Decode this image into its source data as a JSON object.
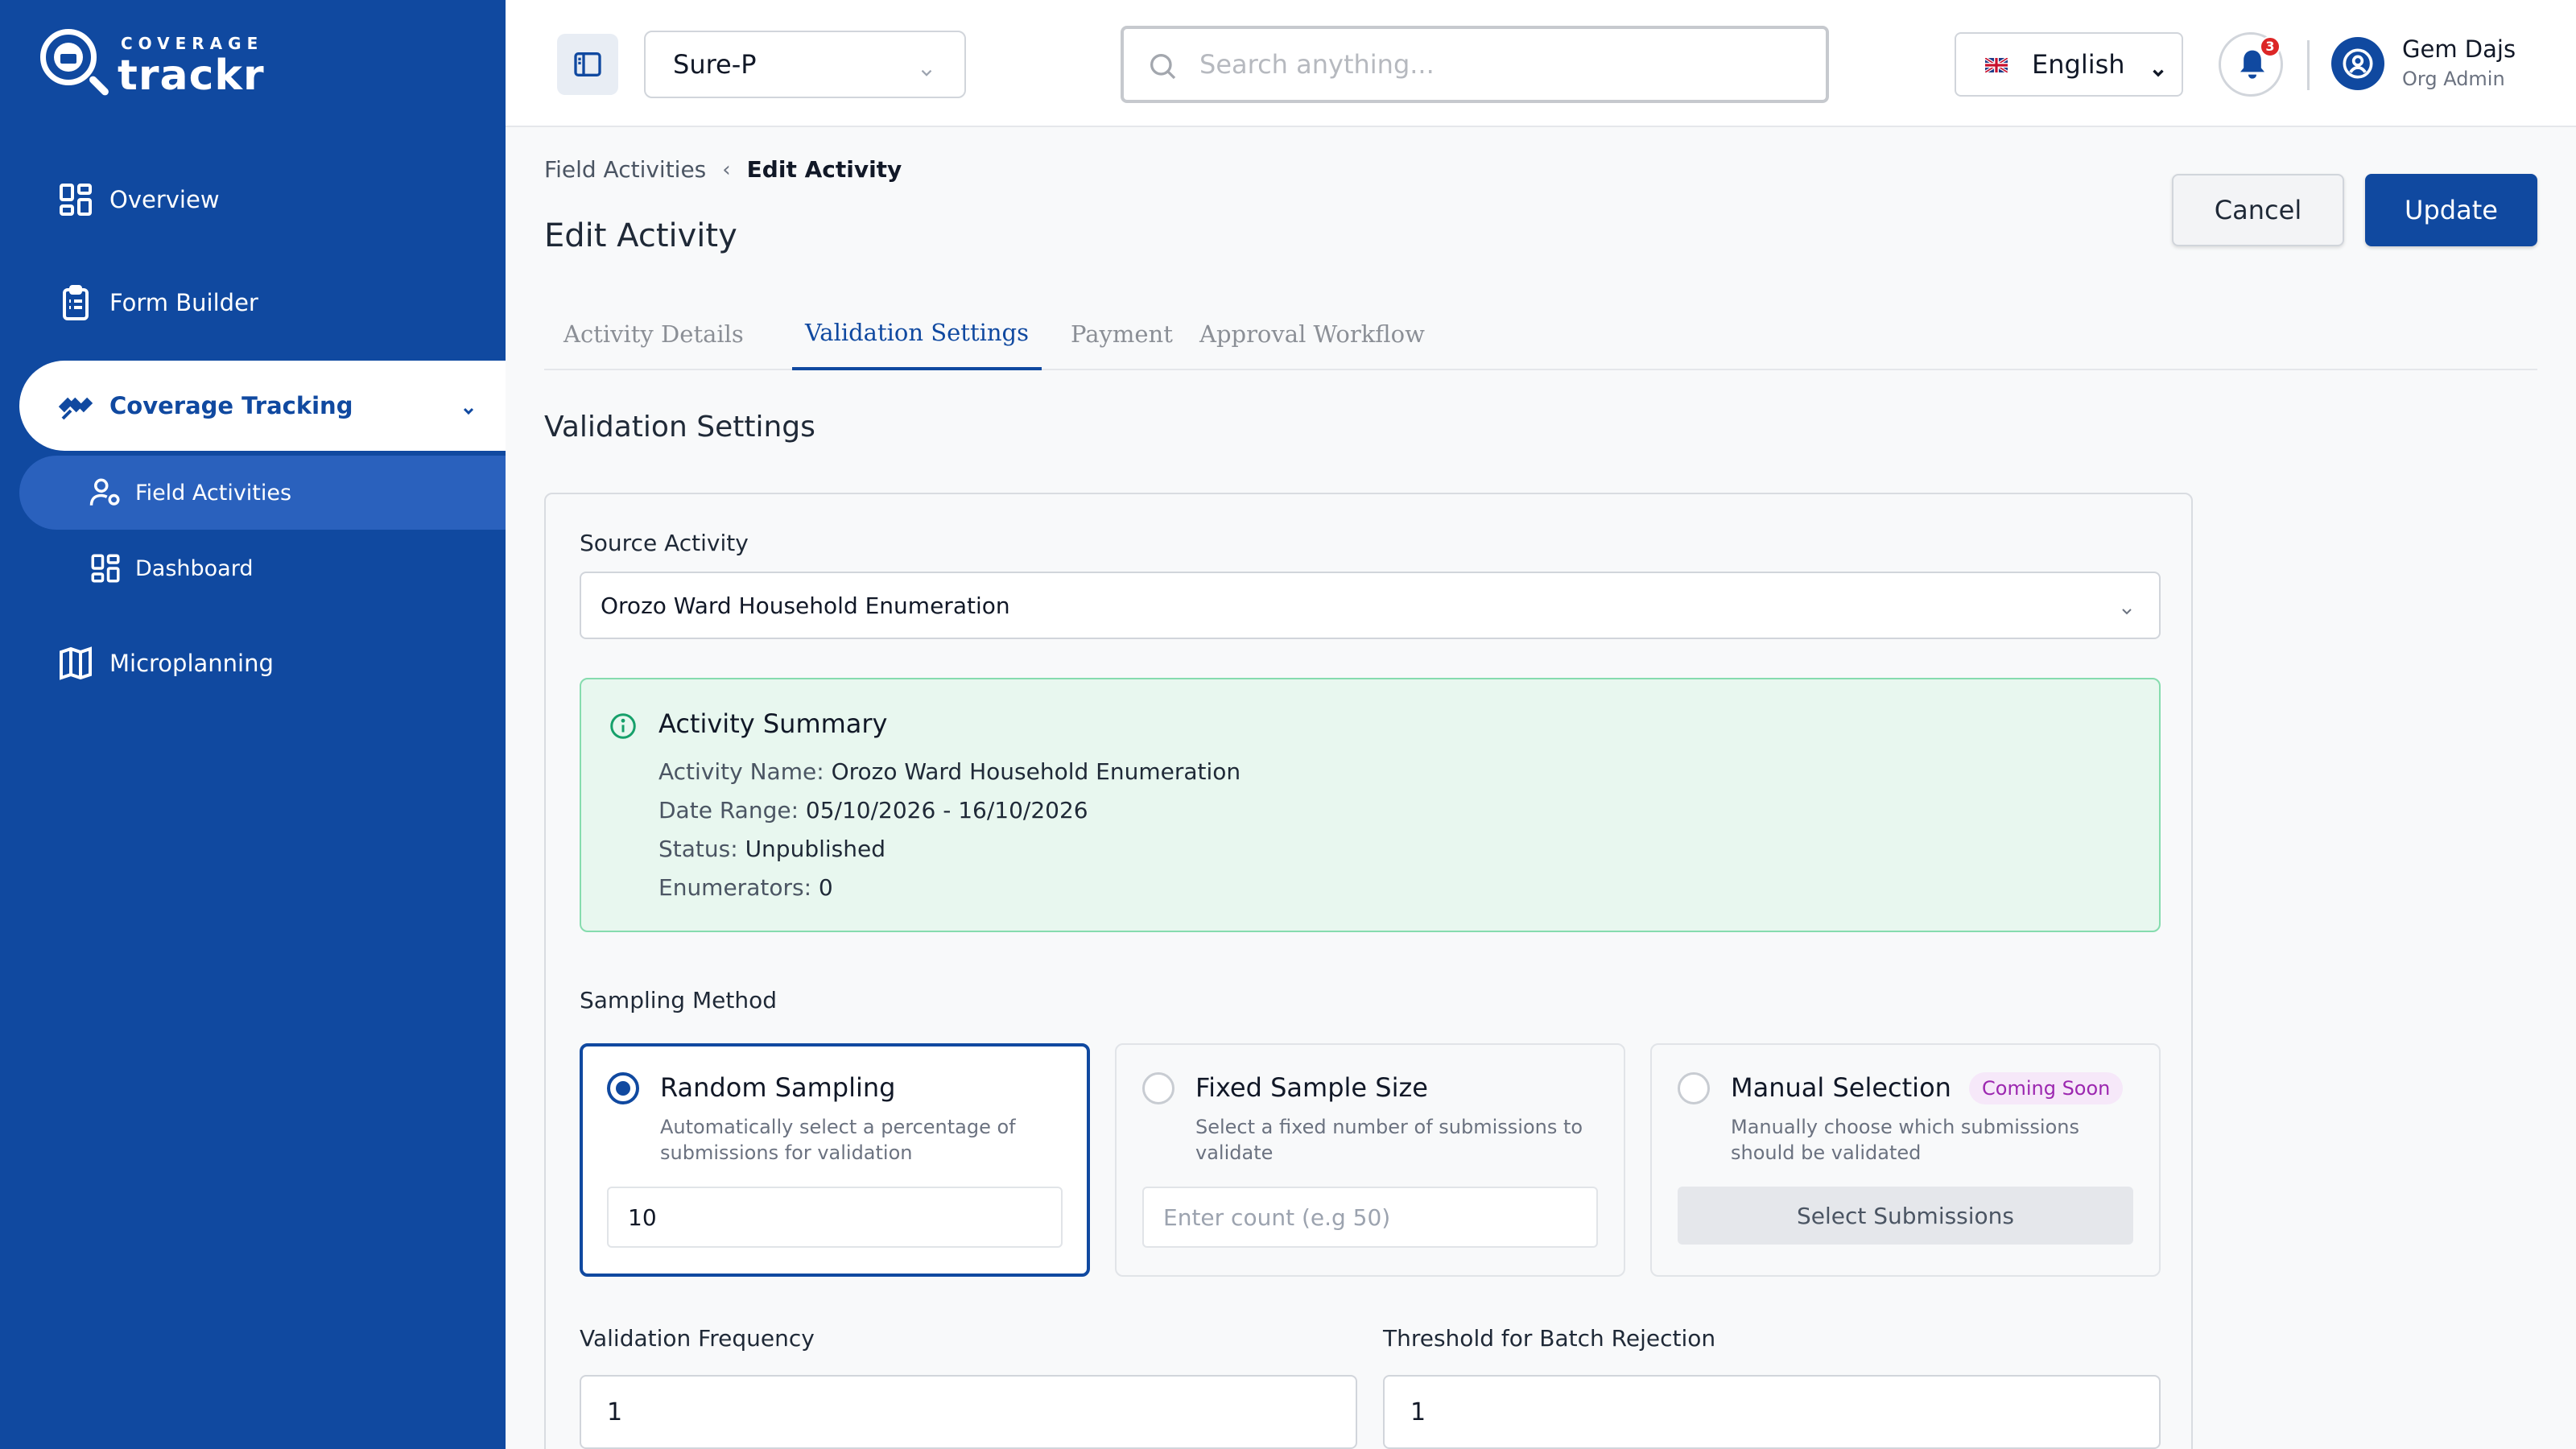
{
  "brand": {
    "top": "COVERAGE",
    "name": "trackr"
  },
  "sidebar": {
    "items": [
      {
        "label": "Overview"
      },
      {
        "label": "Form Builder"
      },
      {
        "label": "Coverage Tracking"
      },
      {
        "label": "Microplanning"
      }
    ],
    "sub_items": [
      {
        "label": "Field Activities"
      },
      {
        "label": "Dashboard"
      }
    ]
  },
  "header": {
    "project": "Sure-P",
    "search_placeholder": "Search anything...",
    "language": "English",
    "notification_count": "3",
    "user_name": "Gem Dajs",
    "user_role": "Org Admin"
  },
  "breadcrumb": {
    "parent": "Field Activities",
    "current": "Edit Activity"
  },
  "page": {
    "title": "Edit Activity",
    "cancel_label": "Cancel",
    "update_label": "Update"
  },
  "tabs": [
    {
      "label": "Activity Details"
    },
    {
      "label": "Validation Settings"
    },
    {
      "label": "Payment"
    },
    {
      "label": "Approval Workflow"
    }
  ],
  "validation": {
    "section_title": "Validation Settings",
    "source_label": "Source Activity",
    "source_value": "Orozo Ward Household Enumeration",
    "summary": {
      "title": "Activity Summary",
      "name_label": "Activity Name: ",
      "name_value": "Orozo Ward Household Enumeration",
      "date_label": "Date Range: ",
      "date_value": "05/10/2026 - 16/10/2026",
      "status_label": "Status: ",
      "status_value": "Unpublished",
      "enum_label": "Enumerators: ",
      "enum_value": "0"
    },
    "sampling_label": "Sampling Method",
    "methods": [
      {
        "title": "Random Sampling",
        "desc": "Automatically select a percentage of submissions for validation",
        "value": "10"
      },
      {
        "title": "Fixed Sample Size",
        "desc": "Select a fixed number of submissions to validate",
        "placeholder": "Enter count (e.g 50)"
      },
      {
        "title": "Manual Selection",
        "badge": "Coming Soon",
        "desc": "Manually choose which submissions should be validated",
        "button": "Select Submissions"
      }
    ],
    "frequency_label": "Validation Frequency",
    "frequency_value": "1",
    "threshold_label": "Threshold for Batch Rejection",
    "threshold_value": "1"
  },
  "colors": {
    "primary": "#1049a0",
    "summary_bg": "#e8f7ef",
    "badge": "#9c27b0"
  }
}
